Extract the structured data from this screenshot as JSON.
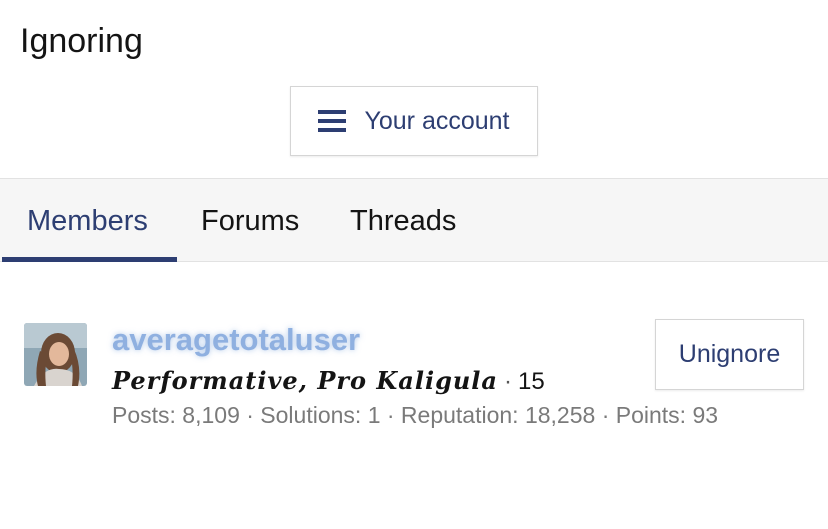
{
  "page": {
    "title": "Ignoring"
  },
  "account_menu": {
    "label": "Your account",
    "icon": "hamburger-icon"
  },
  "tabs": [
    {
      "label": "Members",
      "active": true
    },
    {
      "label": "Forums",
      "active": false
    },
    {
      "label": "Threads",
      "active": false
    }
  ],
  "member": {
    "username": "averagetotaluser",
    "title": "Performative, Pro Kaligula",
    "separator": "·",
    "level": "15",
    "stats": "Posts: 8,109 · Solutions: 1 · Reputation: 18,258 · Points: 93",
    "action_label": "Unignore"
  },
  "colors": {
    "accent": "#2d3e72",
    "username": "#8fb0e0",
    "muted": "#7a7a7a"
  }
}
